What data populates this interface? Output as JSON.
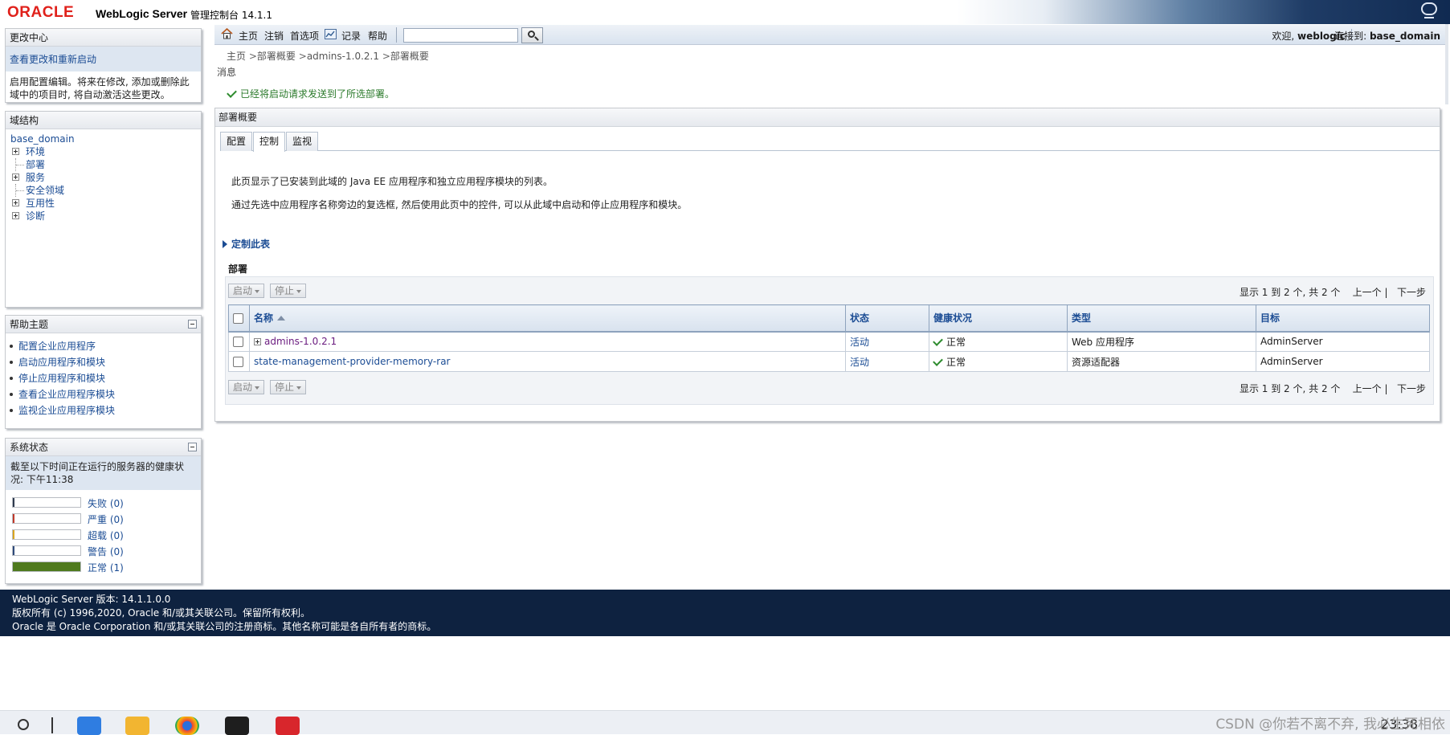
{
  "header": {
    "oracle_logo": "ORACLE",
    "product": "WebLogic Server",
    "subtitle": "管理控制台 14.1.1"
  },
  "change_center": {
    "title": "更改中心",
    "view_changes_link": "查看更改和重新启动",
    "description": "启用配置编辑。将来在修改, 添加或删除此域中的项目时, 将自动激活这些更改。"
  },
  "domain_structure": {
    "title": "域结构",
    "root": "base_domain",
    "items": [
      {
        "label": "环境",
        "expandable": true
      },
      {
        "label": "部署",
        "expandable": false
      },
      {
        "label": "服务",
        "expandable": true
      },
      {
        "label": "安全领域",
        "expandable": false
      },
      {
        "label": "互用性",
        "expandable": true
      },
      {
        "label": "诊断",
        "expandable": true
      }
    ]
  },
  "help_topics": {
    "title": "帮助主题",
    "items": [
      "配置企业应用程序",
      "启动应用程序和模块",
      "停止应用程序和模块",
      "查看企业应用程序模块",
      "监视企业应用程序模块"
    ]
  },
  "system_status": {
    "title": "系统状态",
    "description": "截至以下时间正在运行的服务器的健康状况: 下午11:38",
    "rows": [
      {
        "label": "失败 (0)",
        "count": 0,
        "color": "#2e3a4e"
      },
      {
        "label": "严重 (0)",
        "count": 0,
        "color": "#c0392b"
      },
      {
        "label": "超载 (0)",
        "count": 0,
        "color": "#d9a520"
      },
      {
        "label": "警告 (0)",
        "count": 0,
        "color": "#2e4a7a"
      },
      {
        "label": "正常 (1)",
        "count": 1,
        "color": "#4f7a1e"
      }
    ]
  },
  "toolbar": {
    "home": "主页",
    "logout": "注销",
    "preferences": "首选项",
    "record": "记录",
    "help": "帮助",
    "search_value": "",
    "welcome_prefix": "欢迎,",
    "welcome_user": "weblogic",
    "connected_prefix": "连接到:",
    "connected_domain": "base_domain"
  },
  "breadcrumb": {
    "items": [
      "主页",
      "部署概要",
      "admins-1.0.2.1",
      "部署概要"
    ],
    "sep": ">"
  },
  "messages": {
    "label": "消息",
    "success": "已经将启动请求发送到了所选部署。"
  },
  "main": {
    "title": "部署概要",
    "tabs": [
      "配置",
      "控制",
      "监视"
    ],
    "active_tab": 1,
    "intro1": "此页显示了已安装到此域的 Java EE 应用程序和独立应用程序模块的列表。",
    "intro2": "通过先选中应用程序名称旁边的复选框, 然后使用此页中的控件, 可以从此域中启动和停止应用程序和模块。",
    "customize_link": "定制此表",
    "section_title": "部署",
    "start_button": "启动",
    "stop_button": "停止",
    "pager": {
      "summary": "显示 1 到 2 个, 共 2 个",
      "prev": "上一个",
      "next": "下一步"
    },
    "table": {
      "columns": [
        "名称",
        "状态",
        "健康状况",
        "类型",
        "目标"
      ],
      "rows": [
        {
          "name": "admins-1.0.2.1",
          "expandable": true,
          "status": "活动",
          "health": "正常",
          "type": "Web 应用程序",
          "target": "AdminServer"
        },
        {
          "name": "state-management-provider-memory-rar",
          "expandable": false,
          "status": "活动",
          "health": "正常",
          "type": "资源适配器",
          "target": "AdminServer"
        }
      ]
    }
  },
  "footer": {
    "line1": "WebLogic Server 版本: 14.1.1.0.0",
    "line2": "版权所有 (c) 1996,2020, Oracle 和/或其关联公司。保留所有权利。",
    "line3": "Oracle 是 Oracle Corporation 和/或其关联公司的注册商标。其他名称可能是各自所有者的商标。"
  },
  "taskbar": {
    "watermark": "CSDN @你若不离不弃, 我必生死相依",
    "clock": "23:38"
  }
}
